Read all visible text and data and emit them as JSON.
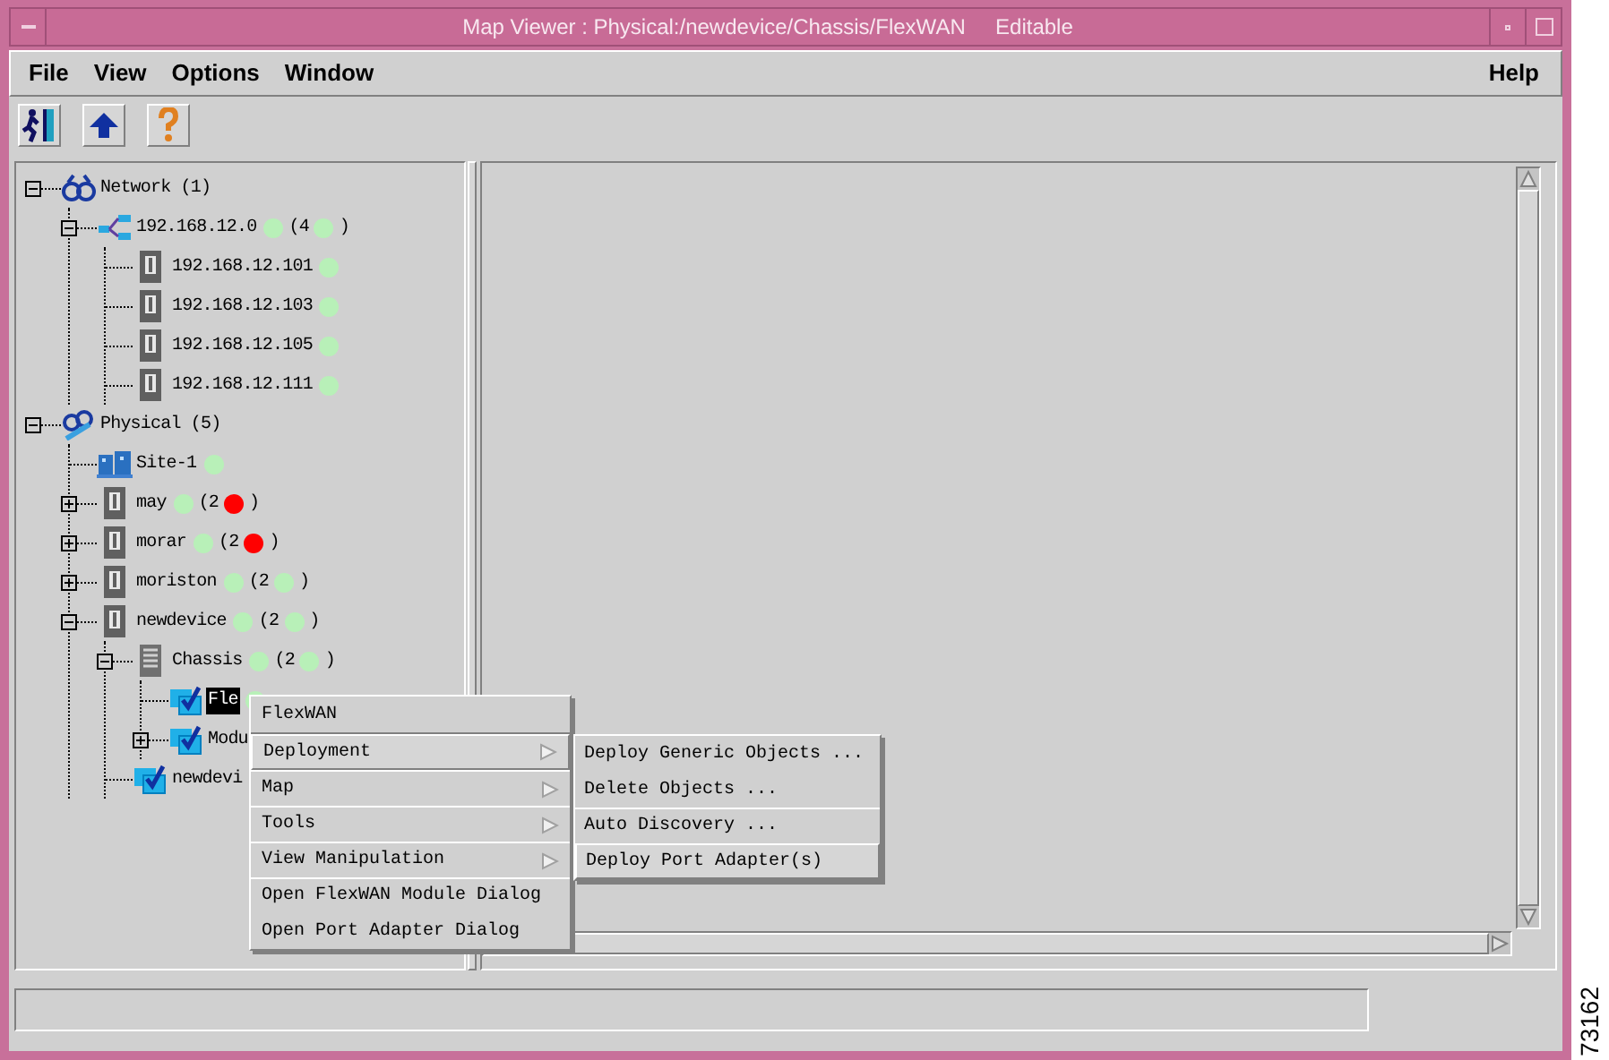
{
  "window": {
    "title": "Map Viewer : Physical:/newdevice/Chassis/FlexWAN     Editable"
  },
  "menu_bar": [
    {
      "label": "File"
    },
    {
      "label": "View"
    },
    {
      "label": "Options"
    },
    {
      "label": "Window"
    }
  ],
  "help_menu": {
    "label": "Help"
  },
  "toolbar": [
    {
      "kind": "exit"
    },
    {
      "kind": "up"
    },
    {
      "kind": "help"
    }
  ],
  "tree": [
    {
      "label": "Network (1)",
      "kind": "binoculars",
      "expanded": true,
      "selected": false,
      "children": [
        {
          "label": "192.168.12.0",
          "kind": "network",
          "expanded": true,
          "selected": false,
          "color": "#b8f0b8",
          "count": {
            "open": "(4",
            "color": "#b8f0b8",
            "close": ")"
          },
          "children": [
            {
              "label": "192.168.12.101",
              "kind": "device",
              "selected": false,
              "color": "#b8f0b8"
            },
            {
              "label": "192.168.12.103",
              "kind": "device",
              "selected": false,
              "color": "#b8f0b8"
            },
            {
              "label": "192.168.12.105",
              "kind": "device",
              "selected": false,
              "color": "#b8f0b8"
            },
            {
              "label": "192.168.12.111",
              "kind": "device",
              "selected": false,
              "color": "#b8f0b8"
            }
          ]
        }
      ]
    },
    {
      "label": "Physical (5)",
      "kind": "map",
      "expanded": true,
      "selected": false,
      "children": [
        {
          "label": "Site-1",
          "kind": "site",
          "selected": false,
          "color": "#b8f0b8"
        },
        {
          "label": "may",
          "kind": "device",
          "expanded": false,
          "selected": false,
          "color": "#b8f0b8",
          "count": {
            "open": "(2",
            "color": "#ff0000",
            "close": ")"
          }
        },
        {
          "label": "morar",
          "kind": "device",
          "expanded": false,
          "selected": false,
          "color": "#b8f0b8",
          "count": {
            "open": "(2",
            "color": "#ff0000",
            "close": ")"
          }
        },
        {
          "label": "moriston",
          "kind": "device",
          "expanded": false,
          "selected": false,
          "color": "#b8f0b8",
          "count": {
            "open": "(2",
            "color": "#b8f0b8",
            "close": ")"
          }
        },
        {
          "label": "newdevice",
          "kind": "device",
          "expanded": true,
          "selected": false,
          "color": "#b8f0b8",
          "count": {
            "open": "(2",
            "color": "#b8f0b8",
            "close": ")"
          },
          "children": [
            {
              "label": "Chassis",
              "kind": "chassis",
              "expanded": true,
              "selected": false,
              "color": "#b8f0b8",
              "count": {
                "open": "(2",
                "color": "#b8f0b8",
                "close": ")"
              },
              "children": [
                {
                  "label": "Fle",
                  "kind": "module",
                  "selected": true,
                  "color": "#b8f0b8"
                },
                {
                  "label": "Modu",
                  "kind": "module",
                  "expanded": false,
                  "selected": false
                }
              ]
            },
            {
              "label": "newdevi",
              "kind": "module",
              "selected": false
            }
          ]
        }
      ]
    }
  ],
  "context_menu": {
    "title": "FlexWAN",
    "items": [
      {
        "label": "Deployment",
        "kind": "submenu",
        "selected": true
      },
      {
        "label": "Map",
        "kind": "submenu",
        "selected": false
      },
      {
        "label": "Tools",
        "kind": "submenu",
        "selected": false
      },
      {
        "label": "View Manipulation",
        "kind": "submenu",
        "selected": false
      },
      {
        "label": "Open FlexWAN Module Dialog",
        "kind": "action",
        "selected": false
      },
      {
        "label": "Open Port Adapter Dialog",
        "kind": "action",
        "selected": false
      }
    ]
  },
  "submenu": {
    "items": [
      {
        "label": "Deploy Generic Objects ...",
        "selected": false
      },
      {
        "label": "Delete Objects ...",
        "selected": false
      },
      {
        "label": "Auto Discovery ...",
        "selected": false
      },
      {
        "label": "Deploy Port Adapter(s)",
        "selected": true
      }
    ]
  },
  "figure_number": "73162"
}
